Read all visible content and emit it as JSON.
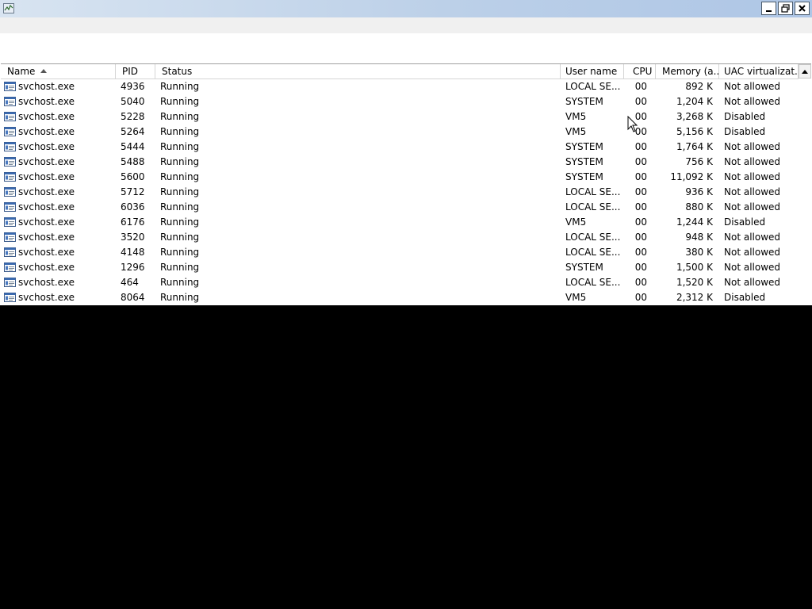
{
  "window": {
    "icon": "task-manager-icon",
    "controls": {
      "minimize": "minimize-icon",
      "restore": "restore-icon",
      "close": "close-icon"
    }
  },
  "table": {
    "columns": [
      {
        "label": "Name",
        "sorted": "ascending"
      },
      {
        "label": "PID"
      },
      {
        "label": "Status"
      },
      {
        "label": "User name"
      },
      {
        "label": "CPU"
      },
      {
        "label": "Memory (a..."
      },
      {
        "label": "UAC virtualizat..."
      }
    ],
    "rows": [
      {
        "name": "svchost.exe",
        "pid": "4936",
        "status": "Running",
        "user": "LOCAL SE...",
        "cpu": "00",
        "memory": "892 K",
        "uac": "Not allowed"
      },
      {
        "name": "svchost.exe",
        "pid": "5040",
        "status": "Running",
        "user": "SYSTEM",
        "cpu": "00",
        "memory": "1,204 K",
        "uac": "Not allowed"
      },
      {
        "name": "svchost.exe",
        "pid": "5228",
        "status": "Running",
        "user": "VM5",
        "cpu": "00",
        "memory": "3,268 K",
        "uac": "Disabled"
      },
      {
        "name": "svchost.exe",
        "pid": "5264",
        "status": "Running",
        "user": "VM5",
        "cpu": "00",
        "memory": "5,156 K",
        "uac": "Disabled"
      },
      {
        "name": "svchost.exe",
        "pid": "5444",
        "status": "Running",
        "user": "SYSTEM",
        "cpu": "00",
        "memory": "1,764 K",
        "uac": "Not allowed"
      },
      {
        "name": "svchost.exe",
        "pid": "5488",
        "status": "Running",
        "user": "SYSTEM",
        "cpu": "00",
        "memory": "756 K",
        "uac": "Not allowed"
      },
      {
        "name": "svchost.exe",
        "pid": "5600",
        "status": "Running",
        "user": "SYSTEM",
        "cpu": "00",
        "memory": "11,092 K",
        "uac": "Not allowed"
      },
      {
        "name": "svchost.exe",
        "pid": "5712",
        "status": "Running",
        "user": "LOCAL SE...",
        "cpu": "00",
        "memory": "936 K",
        "uac": "Not allowed"
      },
      {
        "name": "svchost.exe",
        "pid": "6036",
        "status": "Running",
        "user": "LOCAL SE...",
        "cpu": "00",
        "memory": "880 K",
        "uac": "Not allowed"
      },
      {
        "name": "svchost.exe",
        "pid": "6176",
        "status": "Running",
        "user": "VM5",
        "cpu": "00",
        "memory": "1,244 K",
        "uac": "Disabled"
      },
      {
        "name": "svchost.exe",
        "pid": "3520",
        "status": "Running",
        "user": "LOCAL SE...",
        "cpu": "00",
        "memory": "948 K",
        "uac": "Not allowed"
      },
      {
        "name": "svchost.exe",
        "pid": "4148",
        "status": "Running",
        "user": "LOCAL SE...",
        "cpu": "00",
        "memory": "380 K",
        "uac": "Not allowed"
      },
      {
        "name": "svchost.exe",
        "pid": "1296",
        "status": "Running",
        "user": "SYSTEM",
        "cpu": "00",
        "memory": "1,500 K",
        "uac": "Not allowed"
      },
      {
        "name": "svchost.exe",
        "pid": "464",
        "status": "Running",
        "user": "LOCAL SE...",
        "cpu": "00",
        "memory": "1,520 K",
        "uac": "Not allowed"
      },
      {
        "name": "svchost.exe",
        "pid": "8064",
        "status": "Running",
        "user": "VM5",
        "cpu": "00",
        "memory": "2,312 K",
        "uac": "Disabled"
      }
    ]
  },
  "colors": {
    "titlebar": "#bcd0e8",
    "header_border": "#d5d5d5",
    "desktop": "#000000"
  }
}
